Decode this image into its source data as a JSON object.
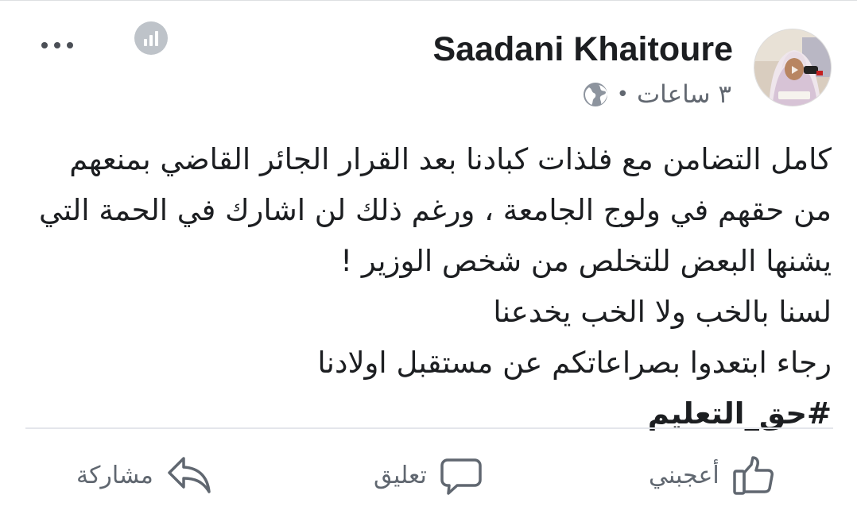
{
  "post": {
    "author": "Saadani Khaitoure",
    "timestamp": "٣ ساعات",
    "separator": "•",
    "privacy_icon": "globe-icon",
    "lines": [
      "كامل التضامن مع فلذات كبادنا بعد القرار الجائر القاضي بمنعهم",
      "من حقهم في ولوج الجامعة ، ورغم ذلك لن اشارك في الحمة التي",
      "يشنها البعض للتخلص من شخص الوزير !",
      "لسنا بالخب ولا الخب يخدعنا",
      "رجاء ابتعدوا بصراعاتكم عن مستقبل اولادنا"
    ],
    "hashtag": "#حق_التعليم"
  },
  "actions": {
    "like_label": "أعجبني",
    "comment_label": "تعليق",
    "share_label": "مشاركة"
  },
  "colors": {
    "text": "#1c1e21",
    "secondary": "#606770",
    "divider": "#e4e6eb",
    "stats_icon": "#bec3c9"
  }
}
